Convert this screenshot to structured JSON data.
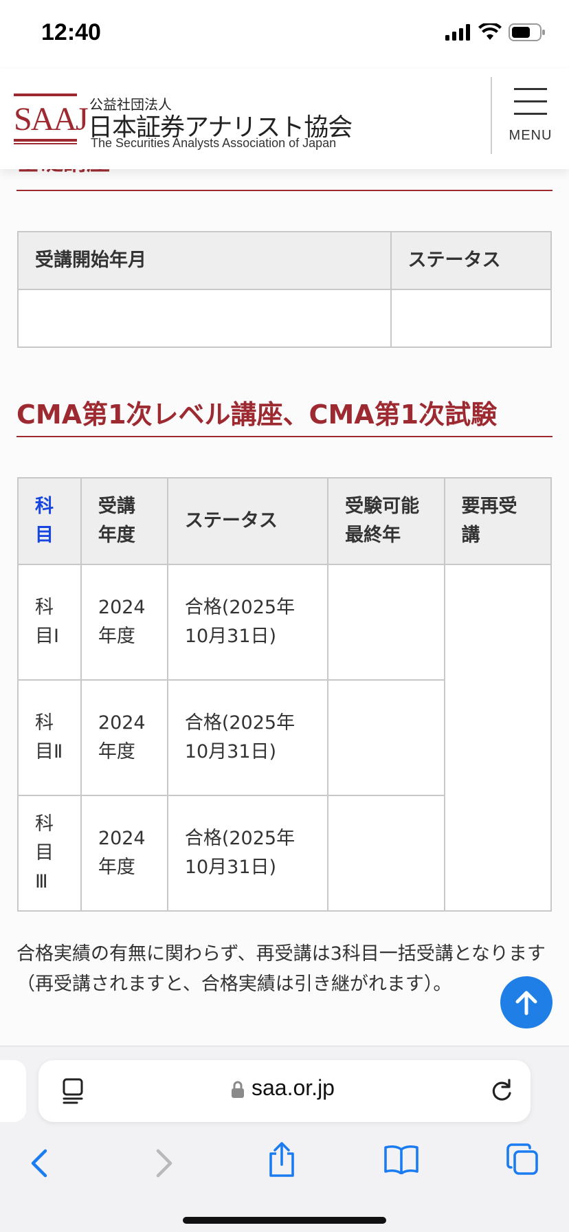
{
  "status_bar": {
    "time": "12:40"
  },
  "header": {
    "logo_text": "SAAJ",
    "org_prefix": "公益社団法人",
    "org_name": "日本証券アナリスト協会",
    "org_name_en": "The Securities Analysts Association of Japan",
    "menu_label": "MENU"
  },
  "basic_table": {
    "headers": [
      "受講開始年月",
      "ステータス"
    ],
    "rows": [
      [
        "",
        ""
      ]
    ]
  },
  "cma_section": {
    "title": "CMA第1次レベル講座、CMA第1次試験",
    "headers": {
      "subject": "科目",
      "year": "受講年度",
      "status": "ステータス",
      "last_year": "受験可能最終年",
      "retake": "要再受講"
    },
    "rows": [
      {
        "subject": "科目Ⅰ",
        "year": "2024年度",
        "status": "合格(2025年10月31日)",
        "last_year": ""
      },
      {
        "subject": "科目Ⅱ",
        "year": "2024年度",
        "status": "合格(2025年10月31日)",
        "last_year": ""
      },
      {
        "subject": "科目Ⅲ",
        "year": "2024年度",
        "status": "合格(2025年10月31日)",
        "last_year": ""
      }
    ],
    "retake_value": "",
    "note": "合格実績の有無に関わらず、再受講は3科目一括受講となります（再受講されますと、合格実績は引き継がれます）。"
  },
  "browser": {
    "url": "saa.or.jp"
  },
  "colors": {
    "accent": "#9d2a31",
    "link": "#1747e0",
    "scroll_top_button": "#1f7fe6"
  }
}
